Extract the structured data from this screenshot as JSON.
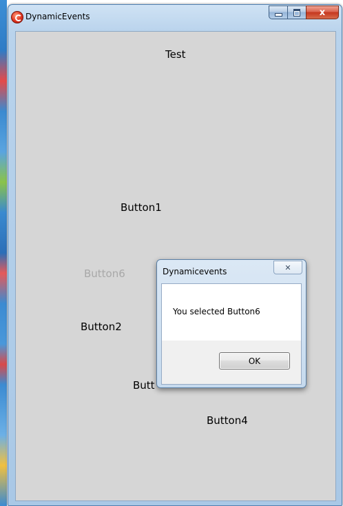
{
  "window": {
    "title": "DynamicEvents",
    "icon": "app-icon",
    "caption_buttons": {
      "minimize": "minimize-icon",
      "maximize": "maximize-icon",
      "close": "x"
    }
  },
  "labels": {
    "test": "Test",
    "button1": "Button1",
    "button6": "Button6",
    "button2": "Button2",
    "button3_partial": "Butt",
    "button4": "Button4"
  },
  "dialog": {
    "title": "Dynamicevents",
    "close_glyph": "✕",
    "message": "You selected Button6",
    "ok_label": "OK"
  },
  "colors": {
    "client_background": "#d6d6d6",
    "disabled_text": "#a8a8a8",
    "close_button": "#c5361e"
  }
}
